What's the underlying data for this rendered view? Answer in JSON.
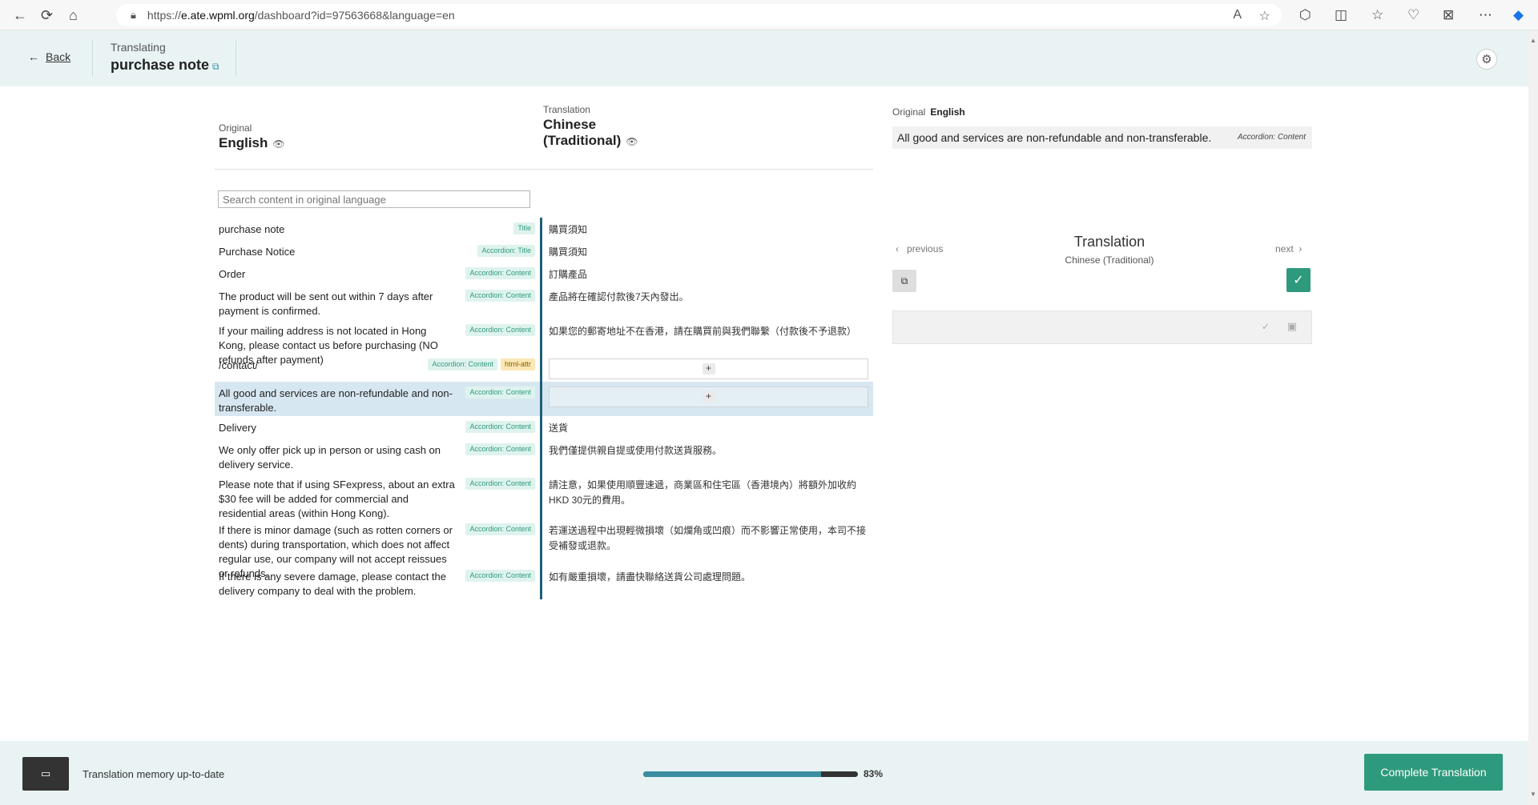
{
  "browser": {
    "url_prefix": "https://",
    "url_domain": "e.ate.wpml.org",
    "url_path": "/dashboard?id=97563668&language=en",
    "back_icon": "←",
    "reload_icon": "⟳",
    "home_icon": "⌂"
  },
  "header": {
    "back_label": "Back",
    "translating_label": "Translating",
    "title": "purchase note"
  },
  "columns": {
    "original_label": "Original",
    "original_lang": "English",
    "translation_label": "Translation",
    "translation_lang_line1": "Chinese",
    "translation_lang_line2": "(Traditional)"
  },
  "search": {
    "placeholder": "Search content in original language"
  },
  "rows": [
    {
      "original": "purchase note",
      "tags": [
        "Title"
      ],
      "translation": "購買須知"
    },
    {
      "original": "Purchase Notice",
      "tags": [
        "Accordion: Title"
      ],
      "translation": "購買須知"
    },
    {
      "original": "Order",
      "tags": [
        "Accordion: Content"
      ],
      "translation": "訂購產品"
    },
    {
      "original": "The product will be sent out within 7 days after payment is confirmed.",
      "tags": [
        "Accordion: Content"
      ],
      "translation": "產品將在確認付款後7天內發出。"
    },
    {
      "original": "If your mailing address is not located in Hong Kong, please contact us before purchasing (NO refunds after payment)",
      "tags": [
        "Accordion: Content"
      ],
      "translation": "如果您的郵寄地址不在香港，請在購買前與我們聯繫（付款後不予退款）"
    },
    {
      "original": "/contact/",
      "tags": [
        "Accordion: Content",
        "html-attr"
      ],
      "translation": ""
    },
    {
      "original": "All good and services are non-refundable and non-transferable.",
      "tags": [
        "Accordion: Content"
      ],
      "translation": ""
    },
    {
      "original": "Delivery",
      "tags": [
        "Accordion: Content"
      ],
      "translation": "送貨"
    },
    {
      "original": "We only offer pick up in person or using cash on delivery service.",
      "tags": [
        "Accordion: Content"
      ],
      "translation": "我們僅提供親自提或使用付款送貨服務。"
    },
    {
      "original": "Please note that if using SFexpress, about an extra $30 fee will be added for commercial and residential areas (within Hong Kong).",
      "tags": [
        "Accordion: Content"
      ],
      "translation": "請注意，如果使用順豐速遞，商業區和住宅區（香港境內）將額外加收約HKD 30元的費用。"
    },
    {
      "original": "If there is minor damage (such as rotten corners or dents) during transportation, which does not affect regular use, our company will not accept reissues or refunds.",
      "tags": [
        "Accordion: Content"
      ],
      "translation": "若運送過程中出現輕微損壞（如爛角或凹痕）而不影響正常使用，本司不接受補發或退款。"
    },
    {
      "original": "If there is any severe damage, please contact the delivery company to deal with the problem.",
      "tags": [
        "Accordion: Content"
      ],
      "translation": "如有嚴重損壞，請盡快聯絡送貨公司處理問題。"
    }
  ],
  "right_panel": {
    "original_label": "Original",
    "original_lang": "English",
    "source_text": "All good and services are non-refundable and non-transferable.",
    "source_tag": "Accordion: Content",
    "previous_label": "previous",
    "next_label": "next",
    "title": "Translation",
    "subtitle": "Chinese (Traditional)"
  },
  "footer": {
    "tm_status": "Translation memory up-to-date",
    "progress_percent": 83,
    "progress_label": "83%",
    "complete_label": "Complete Translation"
  },
  "colors": {
    "accent": "#2e9a7d",
    "divider": "#1f5f7a",
    "header_bg": "#e9f3f4",
    "active_row": "#d7e7f1"
  }
}
